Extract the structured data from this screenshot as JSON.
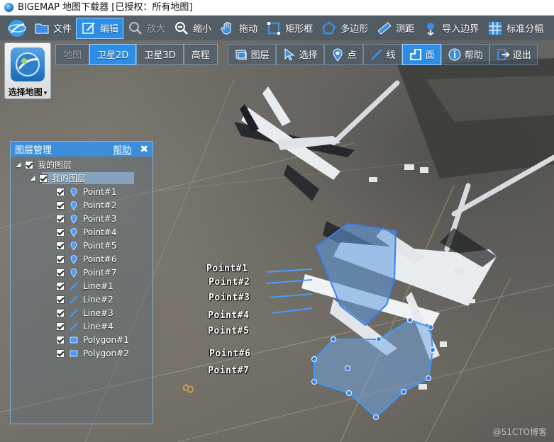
{
  "window": {
    "title": "BIGEMAP 地图下载器 [已授权：所有地图]"
  },
  "toolbar_main": [
    {
      "id": "file",
      "label": "文件",
      "icon": "folder-icon",
      "active": false
    },
    {
      "id": "edit",
      "label": "编辑",
      "icon": "edit-icon",
      "active": true
    },
    {
      "id": "zoom_in",
      "label": "放大",
      "icon": "zoom-in-icon",
      "active": false,
      "dim": true
    },
    {
      "id": "zoom_out",
      "label": "缩小",
      "icon": "zoom-out-icon",
      "active": false
    },
    {
      "id": "pan",
      "label": "拖动",
      "icon": "hand-icon",
      "active": false
    },
    {
      "id": "rectangle",
      "label": "矩形框",
      "icon": "rectangle-icon",
      "active": false
    },
    {
      "id": "polygon",
      "label": "多边形",
      "icon": "polygon-icon",
      "active": false
    },
    {
      "id": "measure",
      "label": "测距",
      "icon": "ruler-icon",
      "active": false
    },
    {
      "id": "import_boundary",
      "label": "导入边界",
      "icon": "import-icon",
      "active": false
    },
    {
      "id": "standard_grid",
      "label": "标准分幅",
      "icon": "grid-icon",
      "active": false
    }
  ],
  "map_types": [
    {
      "id": "map",
      "label": "地图",
      "active": false,
      "dim": true
    },
    {
      "id": "sat2d",
      "label": "卫星2D",
      "active": true
    },
    {
      "id": "sat3d",
      "label": "卫星3D",
      "active": false
    },
    {
      "id": "elevation",
      "label": "高程",
      "active": false
    }
  ],
  "toolbar_secondary": [
    {
      "id": "layers",
      "label": "图层",
      "icon": "layers-icon",
      "active": false
    },
    {
      "id": "select",
      "label": "选择",
      "icon": "select-icon",
      "active": false
    },
    {
      "id": "point",
      "label": "点",
      "icon": "pin-icon",
      "active": false
    },
    {
      "id": "line",
      "label": "线",
      "icon": "line-icon",
      "active": false
    },
    {
      "id": "area",
      "label": "面",
      "icon": "area-icon",
      "active": true
    },
    {
      "id": "help",
      "label": "帮助",
      "icon": "info-icon",
      "active": false
    },
    {
      "id": "exit",
      "label": "退出",
      "icon": "exit-icon",
      "active": false
    }
  ],
  "select_map": {
    "label": "选择地图"
  },
  "layer_panel": {
    "title": "图层管理",
    "help": "帮助",
    "close": "✖",
    "root": {
      "label": "我的图层",
      "checked": true,
      "expanded": true
    },
    "group": {
      "label": "我的图层",
      "checked": true,
      "expanded": true,
      "selected": true
    },
    "items": [
      {
        "label": "Point#1",
        "type": "point",
        "checked": true
      },
      {
        "label": "Point#2",
        "type": "point",
        "checked": true
      },
      {
        "label": "Point#3",
        "type": "point",
        "checked": true
      },
      {
        "label": "Point#4",
        "type": "point",
        "checked": true
      },
      {
        "label": "Point#5",
        "type": "point",
        "checked": true
      },
      {
        "label": "Point#6",
        "type": "point",
        "checked": true
      },
      {
        "label": "Point#7",
        "type": "point",
        "checked": true
      },
      {
        "label": "Line#1",
        "type": "line",
        "checked": true
      },
      {
        "label": "Line#2",
        "type": "line",
        "checked": true
      },
      {
        "label": "Line#3",
        "type": "line",
        "checked": true
      },
      {
        "label": "Line#4",
        "type": "line",
        "checked": true
      },
      {
        "label": "Polygon#1",
        "type": "polygon",
        "checked": true
      },
      {
        "label": "Polygon#2",
        "type": "polygon",
        "checked": true
      }
    ]
  },
  "map_labels": [
    "Point#1",
    "Point#2",
    "Point#3",
    "Point#4",
    "Point#5",
    "Point#6",
    "Point#7"
  ],
  "watermark": "@51CTO博客",
  "colors": {
    "accent": "#2d8ee8",
    "panel_header": "#3d8fdc",
    "line_blue": "#4a9cff",
    "polygon_fill": "#6fa8e8",
    "polygon_stroke": "#3a7ff0"
  }
}
